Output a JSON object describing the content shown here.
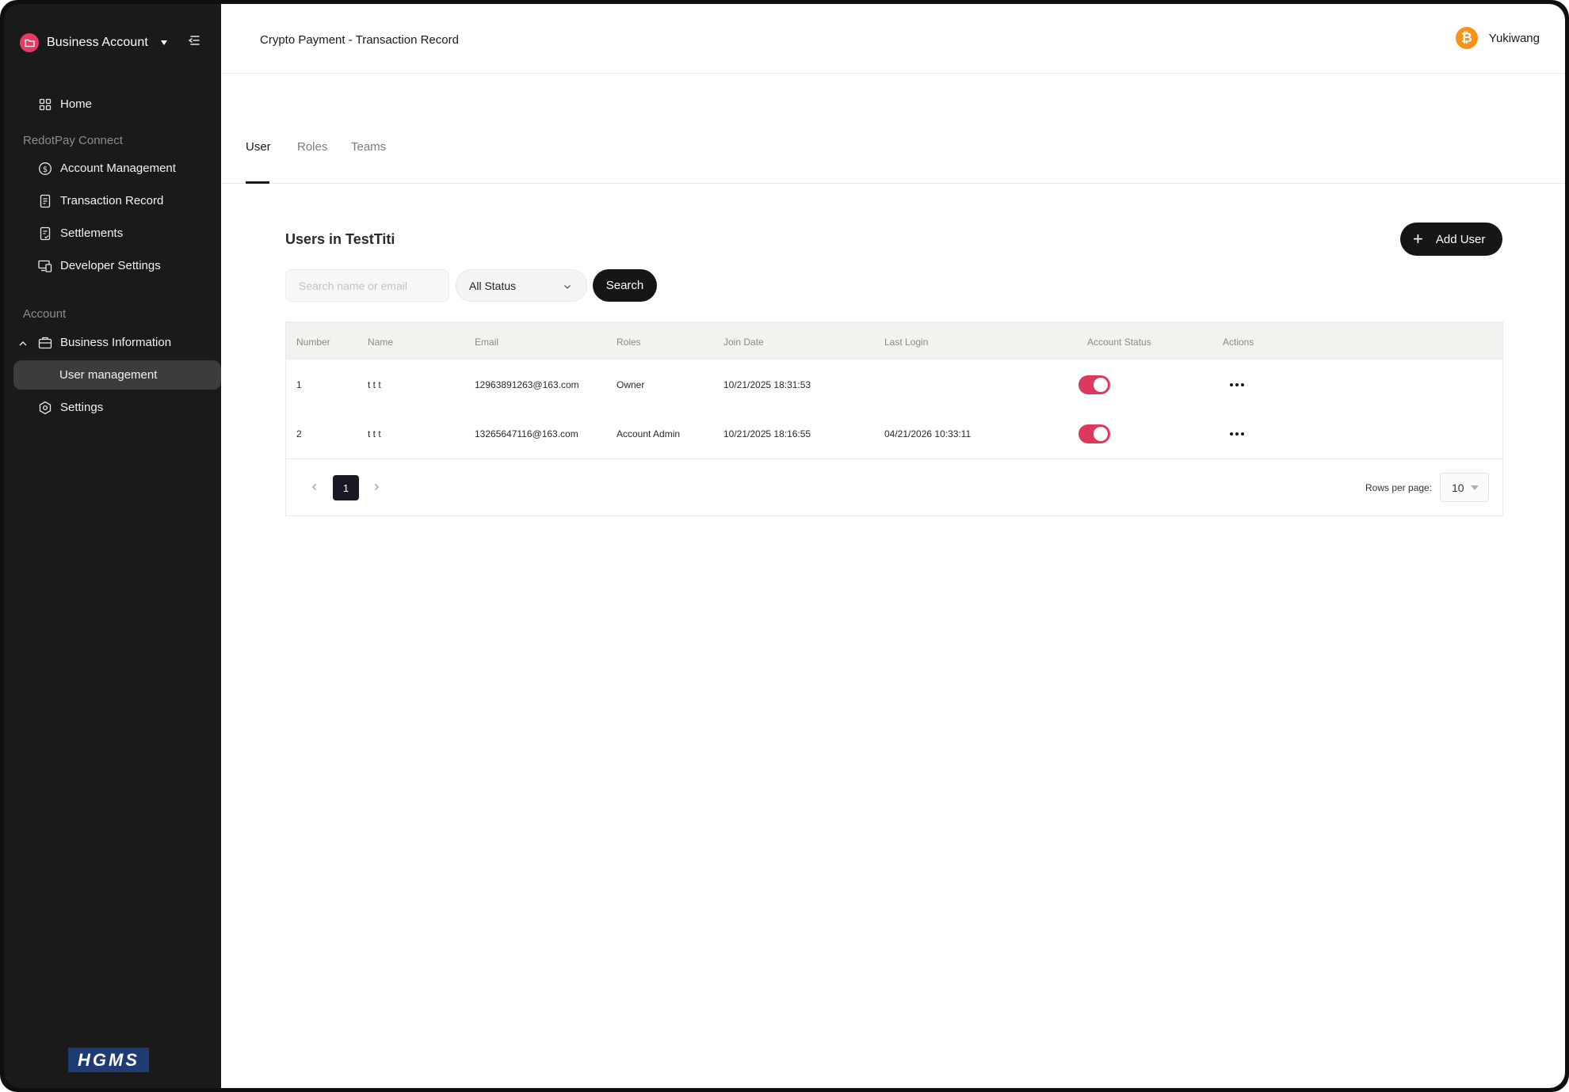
{
  "sidebar": {
    "brand_name": "Business Account",
    "items": [
      {
        "label": "Home",
        "icon": "grid-icon"
      },
      {
        "label": "Account Management",
        "icon": "dollar-circle-icon"
      },
      {
        "label": "Transaction Record",
        "icon": "document-icon"
      },
      {
        "label": "Settlements",
        "icon": "checklist-icon"
      },
      {
        "label": "Developer Settings",
        "icon": "devices-icon"
      },
      {
        "label": "Business Information",
        "icon": "briefcase-icon"
      },
      {
        "label": "User management",
        "icon": ""
      },
      {
        "label": "Settings",
        "icon": "hexagon-settings-icon"
      }
    ],
    "section_connect": "RedotPay Connect",
    "section_account": "Account",
    "footer_logo": "HGMS"
  },
  "header": {
    "title": "Crypto Payment - Transaction Record",
    "username": "Yukiwang",
    "avatar_icon": "bitcoin-icon"
  },
  "tabs": [
    {
      "label": "User",
      "active": true
    },
    {
      "label": "Roles",
      "active": false
    },
    {
      "label": "Teams",
      "active": false
    }
  ],
  "main": {
    "title": "Users in TestTiti",
    "add_button": "Add User",
    "search_placeholder": "Search name or email",
    "status_value": "All Status",
    "search_button": "Search"
  },
  "table": {
    "columns": [
      "Number",
      "Name",
      "Email",
      "Roles",
      "Join Date",
      "Last Login",
      "Account Status",
      "Actions"
    ],
    "rows": [
      {
        "number": "1",
        "name": "t t t",
        "email": "12963891263@163.com",
        "role": "Owner",
        "join_date": "10/21/2025 18:31:53",
        "last_login": "",
        "status_on": true
      },
      {
        "number": "2",
        "name": "t t t",
        "email": "13265647116@163.com",
        "role": "Account Admin",
        "join_date": "10/21/2025 18:16:55",
        "last_login": "04/21/2026 10:33:11",
        "status_on": true
      }
    ]
  },
  "pagination": {
    "current_page": "1",
    "rows_per_page_label": "Rows per page:",
    "rows_per_page": "10"
  },
  "colors": {
    "sidebar_bg": "#1a1a1a",
    "accent": "#dc395c",
    "brand": "#e43c63",
    "bitcoin": "#f7931a",
    "dark_button": "#161616"
  }
}
